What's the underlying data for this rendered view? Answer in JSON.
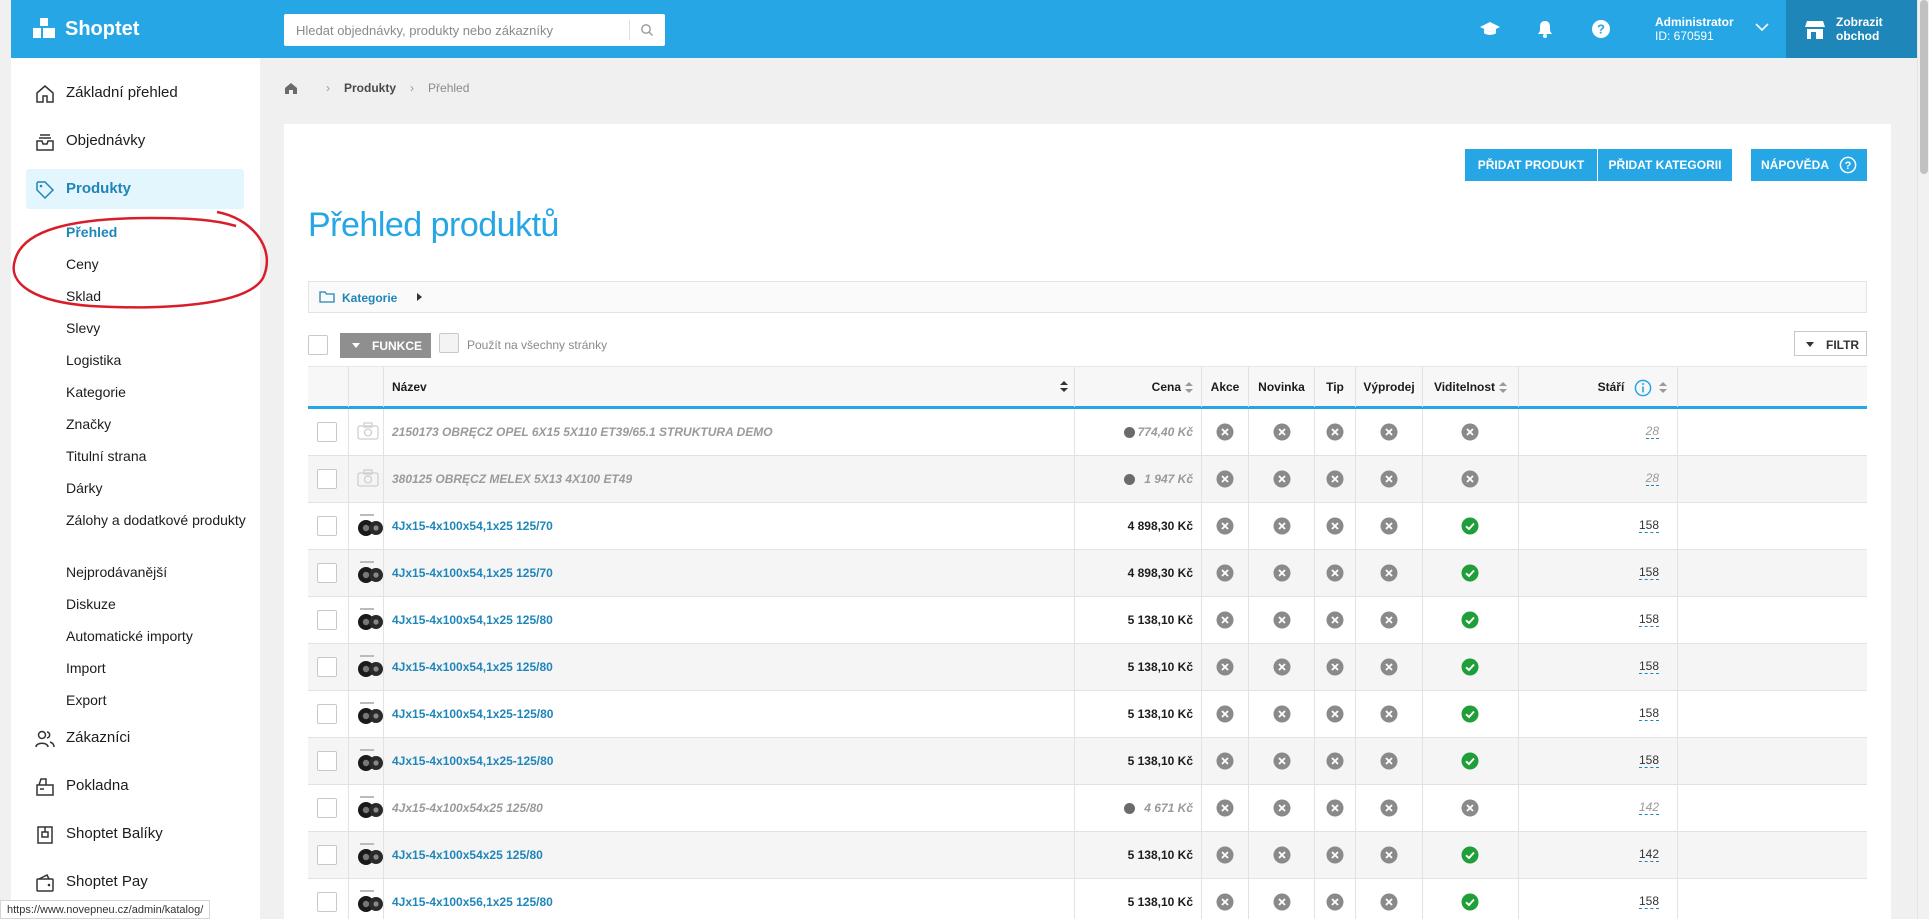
{
  "app": {
    "brand": "Shoptet"
  },
  "search": {
    "placeholder": "Hledat objednávky, produkty nebo zákazníky",
    "value": ""
  },
  "user": {
    "name": "Administrator",
    "id": "ID: 670591"
  },
  "store_button": {
    "line1": "Zobrazit",
    "line2": "obchod"
  },
  "sidebar": {
    "main": [
      {
        "label": "Základní přehled",
        "icon": "home-icon"
      },
      {
        "label": "Objednávky",
        "icon": "orders-icon"
      },
      {
        "label": "Produkty",
        "icon": "tag-icon"
      },
      {
        "label": "Zákazníci",
        "icon": "users-icon"
      },
      {
        "label": "Pokladna",
        "icon": "cash-register-icon"
      },
      {
        "label": "Shoptet Balíky",
        "icon": "package-icon"
      },
      {
        "label": "Shoptet Pay",
        "icon": "wallet-icon"
      }
    ],
    "sub": [
      "Přehled",
      "Ceny",
      "Sklad",
      "Slevy",
      "Logistika",
      "Kategorie",
      "Značky",
      "Titulní strana",
      "Dárky",
      "Zálohy a dodatkové produkty",
      "Nejprodávanější",
      "Diskuze",
      "Automatické importy",
      "Import",
      "Export"
    ]
  },
  "breadcrumb": {
    "section": "Produkty",
    "current": "Přehled"
  },
  "toolbar": {
    "add_product": "PŘIDAT PRODUKT",
    "add_category": "PŘIDAT KATEGORII",
    "help": "NÁPOVĚDA"
  },
  "page": {
    "title": "Přehled produktů"
  },
  "category_bar": {
    "label": "Kategorie"
  },
  "bulk": {
    "funkce": "FUNKCE",
    "all_pages": "Použít na všechny stránky",
    "filter": "FILTR"
  },
  "table": {
    "headers": {
      "name": "Název",
      "price": "Cena",
      "akce": "Akce",
      "novinka": "Novinka",
      "tip": "Tip",
      "vyprodej": "Výprodej",
      "visibility": "Viditelnost",
      "age": "Stáří"
    },
    "rows": [
      {
        "name": "2150173 OBRĘCZ OPEL 6X15 5X110 ET39/65.1 STRUKTURA DEMO",
        "price": "774,40 Kč",
        "visible": false,
        "age": "28",
        "hidden": true,
        "image": false
      },
      {
        "name": "380125 OBRĘCZ MELEX 5X13 4X100 ET49",
        "price": "1 947 Kč",
        "visible": false,
        "age": "28",
        "hidden": true,
        "image": false
      },
      {
        "name": "4Jx15-4x100x54,1x25 125/70",
        "price": "4 898,30 Kč",
        "visible": true,
        "age": "158",
        "hidden": false,
        "image": true
      },
      {
        "name": "4Jx15-4x100x54,1x25 125/70",
        "price": "4 898,30 Kč",
        "visible": true,
        "age": "158",
        "hidden": false,
        "image": true
      },
      {
        "name": "4Jx15-4x100x54,1x25 125/80",
        "price": "5 138,10 Kč",
        "visible": true,
        "age": "158",
        "hidden": false,
        "image": true
      },
      {
        "name": "4Jx15-4x100x54,1x25 125/80",
        "price": "5 138,10 Kč",
        "visible": true,
        "age": "158",
        "hidden": false,
        "image": true
      },
      {
        "name": "4Jx15-4x100x54,1x25-125/80",
        "price": "5 138,10 Kč",
        "visible": true,
        "age": "158",
        "hidden": false,
        "image": true
      },
      {
        "name": "4Jx15-4x100x54,1x25-125/80",
        "price": "5 138,10 Kč",
        "visible": true,
        "age": "158",
        "hidden": false,
        "image": true
      },
      {
        "name": "4Jx15-4x100x54x25 125/80",
        "price": "4 671 Kč",
        "visible": false,
        "age": "142",
        "hidden": true,
        "image": true
      },
      {
        "name": "4Jx15-4x100x54x25 125/80",
        "price": "5 138,10 Kč",
        "visible": true,
        "age": "142",
        "hidden": false,
        "image": true
      },
      {
        "name": "4Jx15-4x100x56,1x25 125/80",
        "price": "5 138,10 Kč",
        "visible": true,
        "age": "158",
        "hidden": false,
        "image": true
      }
    ]
  },
  "status_bar": {
    "url": "https://www.novepneu.cz/admin/katalog/"
  },
  "colors": {
    "accent": "#26a6e4",
    "link": "#1e86b8",
    "ok": "#1f9e3a",
    "no": "#8a8a8a",
    "annotation": "#d81e2a"
  }
}
